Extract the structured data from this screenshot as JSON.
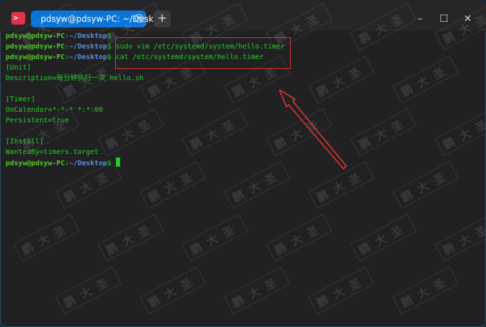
{
  "window": {
    "tab_title": "pdsyw@pdsyw-PC: ~/Desktop",
    "tab_close": "×",
    "new_tab": "+",
    "minimize": "–",
    "maximize": "☐",
    "close": "✕",
    "icon_text": ">"
  },
  "terminal": {
    "prompt_user": "pdsyw@pdsyw-PC",
    "prompt_sep": ":",
    "prompt_path": "~/Desktop",
    "prompt_symbol": "$",
    "commands": [
      "",
      "sudo vim /etc/systemd/system/hello.timer",
      "cat /etc/systemd/system/hello.timer"
    ],
    "output": [
      "[Unit]",
      "Description=每分钟执行一次 hello.sh",
      "",
      "[Timer]",
      "OnCalendar=*-*-* *:*:00",
      "Persistent=true",
      "",
      "[Install]",
      "WantedBy=timers.target"
    ]
  },
  "colors": {
    "annotation": "#e03434",
    "tab_active": "#0a74d8",
    "text_green": "#1fd11f",
    "path_blue": "#5b8ed6"
  },
  "watermark_text": "鹏大圣"
}
